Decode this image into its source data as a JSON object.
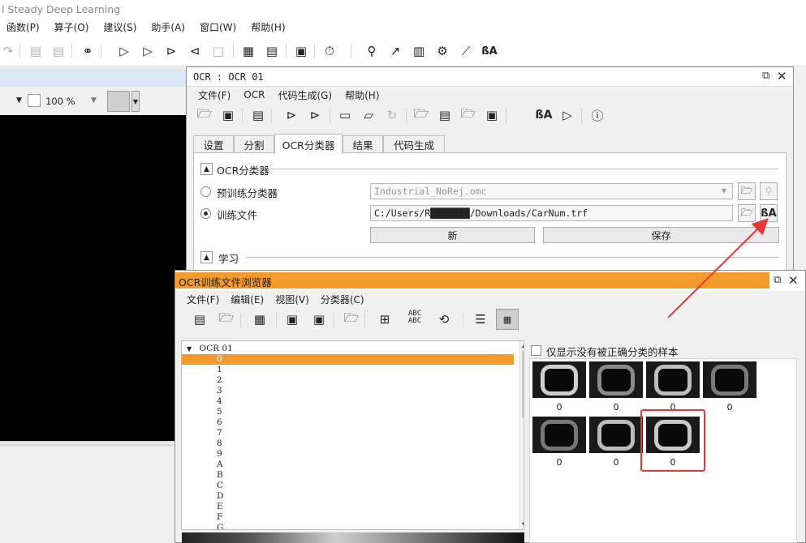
{
  "app": {
    "title": "l Steady Deep Learning",
    "menu": [
      "函数(P)",
      "算子(O)",
      "建议(S)",
      "助手(A)",
      "窗口(W)",
      "帮助(H)"
    ],
    "zoom": "100 %"
  },
  "ocr_window": {
    "title": "OCR : OCR 01",
    "menu": [
      "文件(F)",
      "OCR",
      "代码生成(G)",
      "帮助(H)"
    ],
    "tabs": [
      "设置",
      "分割",
      "OCR分类器",
      "结果",
      "代码生成"
    ],
    "active_tab": "OCR分类器",
    "section_classifier": "OCR分类器",
    "radio_pretrained": "预训练分类器",
    "pretrained_value": "Industrial_NoRej.omc",
    "radio_trainfile": "训练文件",
    "trainfile_value": "C:/Users/R███████/Downloads/CarNum.trf",
    "btn_new": "新",
    "btn_save": "保存",
    "section_learn": "学习"
  },
  "browser_window": {
    "title": "OCR训练文件浏览器",
    "menu": [
      "文件(F)",
      "编辑(E)",
      "视图(V)",
      "分类器(C)"
    ],
    "tree_root": "OCR 01",
    "tree_items": [
      "0",
      "1",
      "2",
      "3",
      "4",
      "5",
      "6",
      "7",
      "8",
      "9",
      "A",
      "B",
      "C",
      "D",
      "E",
      "F",
      "G"
    ],
    "selected_item": "0",
    "checkbox_label": "仅显示没有被正确分类的样本",
    "thumbnails": [
      "0",
      "0",
      "0",
      "0",
      "0",
      "0",
      "0"
    ]
  },
  "colors": {
    "accent_orange": "#f39a2d",
    "highlight_red": "#e53935"
  }
}
